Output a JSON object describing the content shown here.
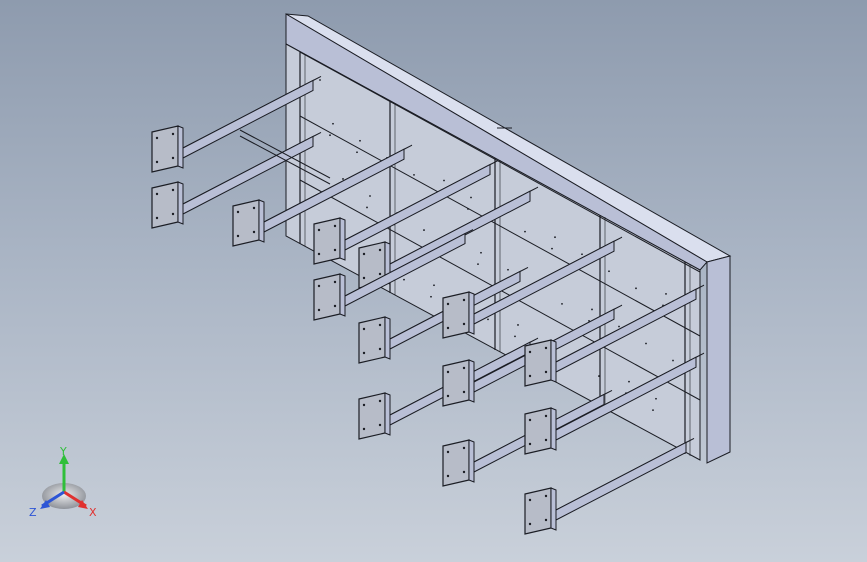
{
  "viewport": {
    "background_top": "#8e9bae",
    "background_bottom": "#c9d0da"
  },
  "model": {
    "frame_fill": "#dadfee",
    "frame_side": "#b9bfd6",
    "panel_fill": "#c6ccd9",
    "beam_fill": "#d9dde9",
    "edge_color": "#1b1d24",
    "plate_fill": "#b7bcc8"
  },
  "triad": {
    "x_label": "X",
    "y_label": "Y",
    "z_label": "Z",
    "x_color": "#e0312f",
    "y_color": "#2fbf3a",
    "z_color": "#2d55d6"
  }
}
